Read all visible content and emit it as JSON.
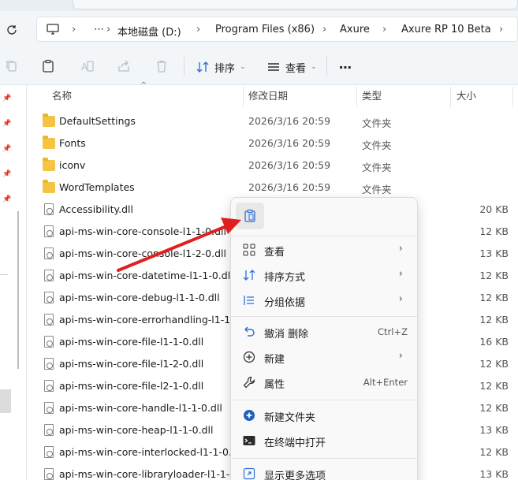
{
  "address": {
    "crumbs": [
      "本地磁盘 (D:)",
      "Program Files (x86)",
      "Axure",
      "Axure RP 10 Beta"
    ],
    "more": "⋯"
  },
  "toolbar": {
    "sort_label": "排序",
    "view_label": "查看",
    "more_label": "⋯"
  },
  "columns": {
    "name": "名称",
    "date": "修改日期",
    "type": "类型",
    "size": "大小"
  },
  "files": [
    {
      "name": "DefaultSettings",
      "date": "2026/3/16 20:59",
      "type": "文件夹",
      "size": "",
      "kind": "folder"
    },
    {
      "name": "Fonts",
      "date": "2026/3/16 20:59",
      "type": "文件夹",
      "size": "",
      "kind": "folder"
    },
    {
      "name": "iconv",
      "date": "2026/3/16 20:59",
      "type": "文件夹",
      "size": "",
      "kind": "folder"
    },
    {
      "name": "WordTemplates",
      "date": "2026/3/16 20:59",
      "type": "文件夹",
      "size": "",
      "kind": "folder"
    },
    {
      "name": "Accessibility.dll",
      "date": "",
      "type": "",
      "size": "20 KB",
      "kind": "dll"
    },
    {
      "name": "api-ms-win-core-console-l1-1-0.dll",
      "date": "",
      "type": "",
      "size": "12 KB",
      "kind": "dll"
    },
    {
      "name": "api-ms-win-core-console-l1-2-0.dll",
      "date": "",
      "type": "",
      "size": "13 KB",
      "kind": "dll"
    },
    {
      "name": "api-ms-win-core-datetime-l1-1-0.dll",
      "date": "",
      "type": "",
      "size": "12 KB",
      "kind": "dll"
    },
    {
      "name": "api-ms-win-core-debug-l1-1-0.dll",
      "date": "",
      "type": "",
      "size": "12 KB",
      "kind": "dll"
    },
    {
      "name": "api-ms-win-core-errorhandling-l1-1-...",
      "date": "",
      "type": "",
      "size": "12 KB",
      "kind": "dll"
    },
    {
      "name": "api-ms-win-core-file-l1-1-0.dll",
      "date": "",
      "type": "",
      "size": "16 KB",
      "kind": "dll"
    },
    {
      "name": "api-ms-win-core-file-l1-2-0.dll",
      "date": "",
      "type": "",
      "size": "12 KB",
      "kind": "dll"
    },
    {
      "name": "api-ms-win-core-file-l2-1-0.dll",
      "date": "",
      "type": "",
      "size": "12 KB",
      "kind": "dll"
    },
    {
      "name": "api-ms-win-core-handle-l1-1-0.dll",
      "date": "",
      "type": "",
      "size": "12 KB",
      "kind": "dll"
    },
    {
      "name": "api-ms-win-core-heap-l1-1-0.dll",
      "date": "",
      "type": "",
      "size": "13 KB",
      "kind": "dll"
    },
    {
      "name": "api-ms-win-core-interlocked-l1-1-0.dll",
      "date": "",
      "type": "",
      "size": "12 KB",
      "kind": "dll"
    },
    {
      "name": "api-ms-win-core-libraryloader-l1-1-0...",
      "date": "",
      "type": "",
      "size": "13 KB",
      "kind": "dll"
    }
  ],
  "context_menu": {
    "view": "查看",
    "sort_by": "排序方式",
    "group_by": "分组依据",
    "undo_delete": "撤消 删除",
    "undo_shortcut": "Ctrl+Z",
    "new": "新建",
    "properties": "属性",
    "properties_shortcut": "Alt+Enter",
    "new_folder": "新建文件夹",
    "open_terminal": "在终端中打开",
    "show_more": "显示更多选项",
    "arrow_glyph": "›"
  },
  "colors": {
    "folder": "#f4c542",
    "annotation_arrow": "#e02020",
    "accent": "#1a73e8"
  }
}
